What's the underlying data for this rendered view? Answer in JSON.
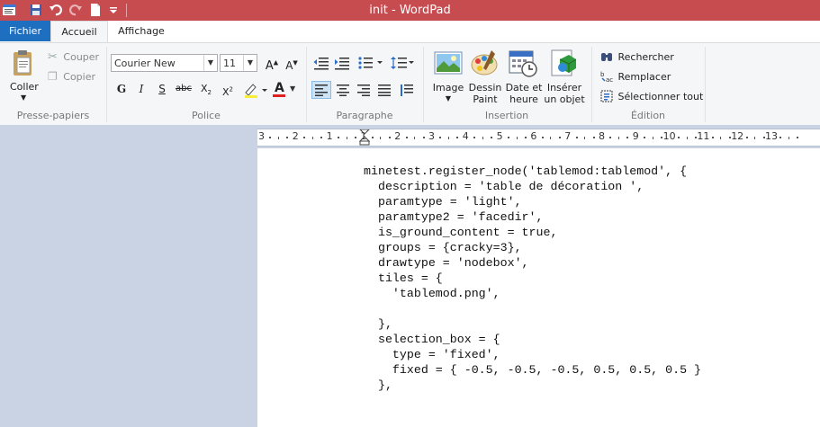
{
  "window": {
    "title": "init - WordPad"
  },
  "tabs": {
    "file": "Fichier",
    "home": "Accueil",
    "view": "Affichage"
  },
  "clipboard": {
    "paste": "Coller",
    "cut": "Couper",
    "copy": "Copier",
    "group": "Presse-papiers"
  },
  "font": {
    "family": "Courier New",
    "size": "11",
    "group": "Police"
  },
  "paragraph": {
    "group": "Paragraphe"
  },
  "insert": {
    "image": "Image",
    "paint_line1": "Dessin",
    "paint_line2": "Paint",
    "date_line1": "Date et",
    "date_line2": "heure",
    "object_line1": "Insérer",
    "object_line2": "un objet",
    "group": "Insertion"
  },
  "editing": {
    "find": "Rechercher",
    "replace": "Remplacer",
    "select_all": "Sélectionner tout",
    "group": "Édition"
  },
  "ruler": {
    "labels": [
      "3",
      "2",
      "1",
      "1",
      "2",
      "3",
      "4",
      "5",
      "6",
      "7",
      "8",
      "9",
      "10",
      "11",
      "12",
      "13"
    ]
  },
  "document": {
    "lines": [
      "minetest.register_node('tablemod:tablemod', {",
      "  description = 'table de décoration ',",
      "  paramtype = 'light',",
      "  paramtype2 = 'facedir',",
      "  is_ground_content = true,",
      "  groups = {cracky=3},",
      "  drawtype = 'nodebox',",
      "  tiles = {",
      "    'tablemod.png',",
      "",
      "  },",
      "  selection_box = {",
      "    type = 'fixed',",
      "    fixed = { -0.5, -0.5, -0.5, 0.5, 0.5, 0.5 }",
      "  },"
    ]
  },
  "colors": {
    "titlebar": "#c74c50",
    "file_tab": "#1f6fc1",
    "workspace": "#c9d3e3"
  }
}
